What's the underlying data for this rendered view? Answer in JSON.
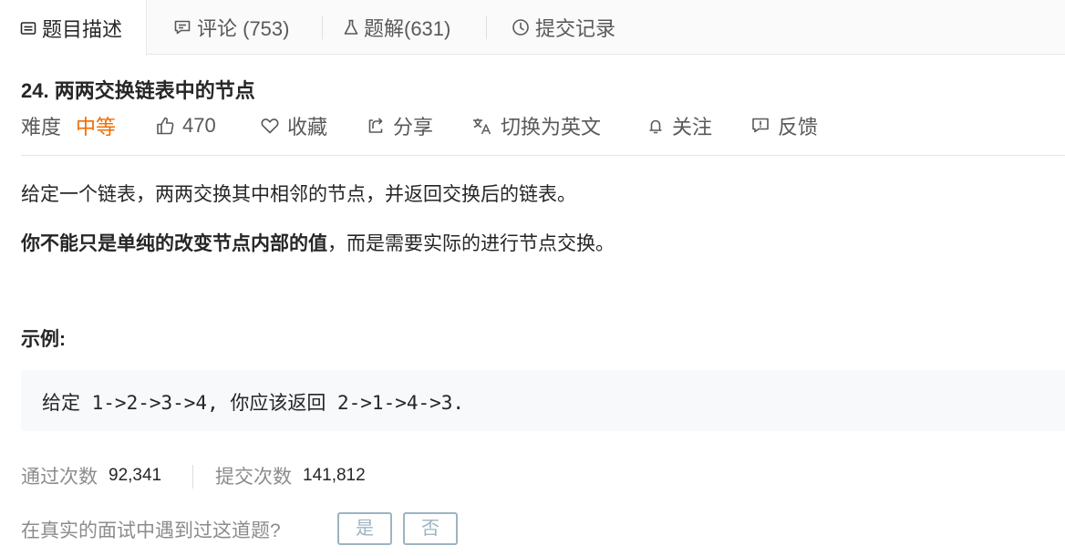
{
  "tabs": [
    {
      "label": "题目描述",
      "icon": "description-icon",
      "active": true
    },
    {
      "label": "评论 (753)",
      "icon": "comment-icon",
      "active": false
    },
    {
      "label": "题解(631)",
      "icon": "flask-icon",
      "active": false
    },
    {
      "label": "提交记录",
      "icon": "clock-icon",
      "active": false
    }
  ],
  "problem": {
    "title": "24. 两两交换链表中的节点",
    "difficulty_label": "难度",
    "difficulty_value": "中等",
    "difficulty_color": "#ef6c00",
    "likes": "470",
    "favorite_label": "收藏",
    "share_label": "分享",
    "switch_lang_label": "切换为英文",
    "follow_label": "关注",
    "feedback_label": "反馈"
  },
  "content": {
    "para1": "给定一个链表，两两交换其中相邻的节点，并返回交换后的链表。",
    "para2_bold": "你不能只是单纯的改变节点内部的值",
    "para2_rest": "，而是需要实际的进行节点交换。",
    "example_label": "示例:",
    "example_code": "给定 1->2->3->4, 你应该返回 2->1->4->3."
  },
  "stats": {
    "accepted_label": "通过次数",
    "accepted_value": "92,341",
    "submitted_label": "提交次数",
    "submitted_value": "141,812"
  },
  "interview": {
    "question": "在真实的面试中遇到过这道题?",
    "yes": "是",
    "no": "否"
  }
}
